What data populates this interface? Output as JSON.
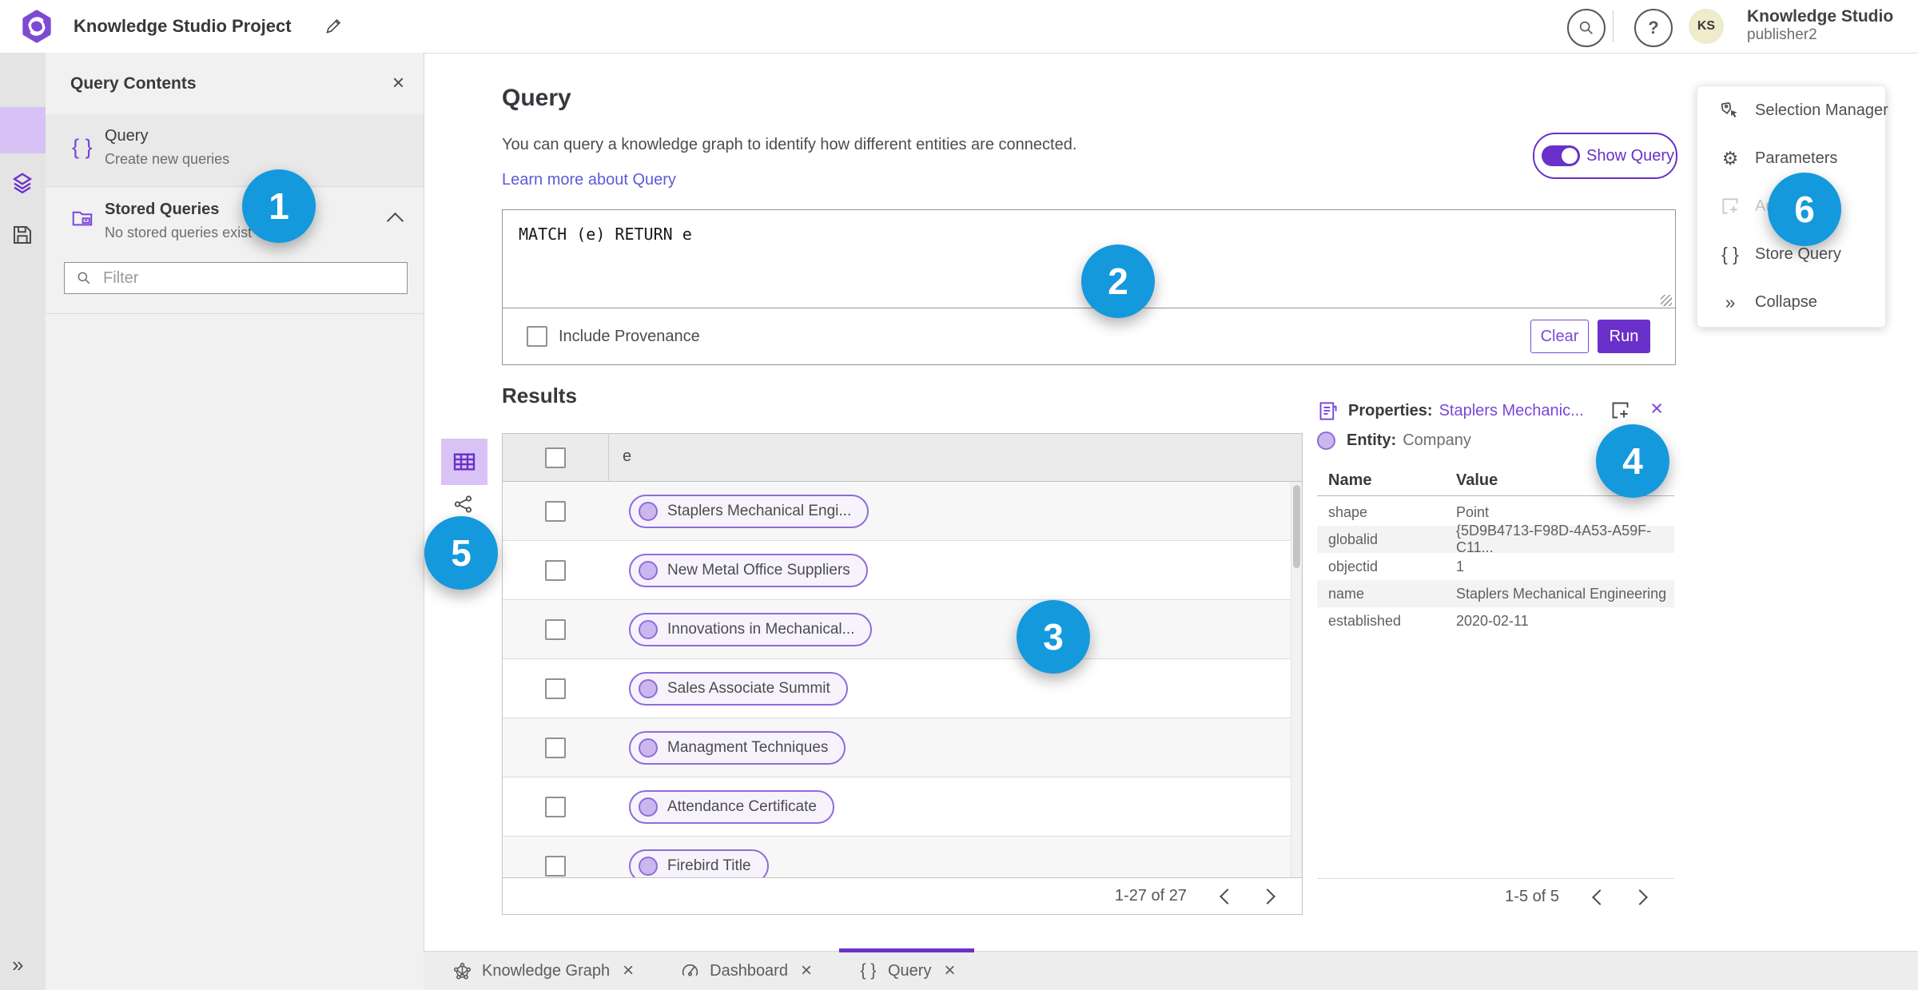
{
  "colors": {
    "accent_purple": "#6a30c9",
    "icon_purple": "#7a46d9",
    "pill_border": "#8f6cdb",
    "badge_blue": "#1599dd",
    "link_blue": "#5d5bd4"
  },
  "icons": {
    "close": "×",
    "braces": "{ }",
    "gear": "⚙",
    "collapse": "»",
    "expand": "»",
    "help": "?"
  },
  "topbar": {
    "title": "Knowledge Studio Project",
    "user_name": "Knowledge Studio",
    "user_role": "publisher2",
    "avatar_initials": "KS"
  },
  "contents_panel": {
    "title": "Query Contents",
    "query_item": {
      "label": "Query",
      "description": "Create new queries"
    },
    "stored_item": {
      "label": "Stored Queries",
      "description": "No stored queries exist"
    },
    "filter_placeholder": "Filter"
  },
  "query_panel": {
    "heading": "Query",
    "description": "You can query a knowledge graph to identify how different entities are connected.",
    "learn_more": "Learn more about Query",
    "show_query": "Show Query",
    "query_text": "MATCH (e) RETURN e",
    "include_provenance": "Include Provenance",
    "clear": "Clear",
    "run": "Run"
  },
  "results": {
    "heading": "Results",
    "column": "e",
    "rows": [
      "Staplers Mechanical Engi...",
      "New Metal Office Suppliers",
      "Innovations in Mechanical...",
      "Sales Associate Summit",
      "Managment Techniques",
      "Attendance Certificate",
      "Firebird Title"
    ],
    "pagination": "1-27 of 27"
  },
  "properties": {
    "label": "Properties:",
    "link": "Staplers Mechanic...",
    "entity_label": "Entity:",
    "entity_value": "Company",
    "name_header": "Name",
    "value_header": "Value",
    "rows": [
      {
        "name": "shape",
        "value": "Point"
      },
      {
        "name": "globalid",
        "value": "{5D9B4713-F98D-4A53-A59F-C11..."
      },
      {
        "name": "objectid",
        "value": "1"
      },
      {
        "name": "name",
        "value": "Staplers Mechanical Engineering"
      },
      {
        "name": "established",
        "value": "2020-02-11"
      }
    ],
    "pagination": "1-5 of 5"
  },
  "right_menu": {
    "items": [
      "Selection Manager",
      "Parameters",
      "Ad",
      "Store Query",
      "Collapse"
    ]
  },
  "tabs": [
    {
      "label": "Knowledge Graph"
    },
    {
      "label": "Dashboard"
    },
    {
      "label": "Query"
    }
  ],
  "badges": [
    "1",
    "2",
    "3",
    "4",
    "5",
    "6"
  ]
}
